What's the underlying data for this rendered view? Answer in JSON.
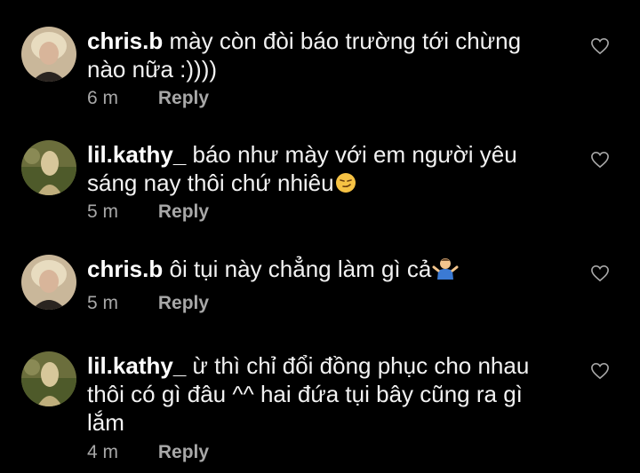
{
  "comments": [
    {
      "username": "chris.b",
      "text": "mày còn đòi báo trường tới chừng nào nữa :))))",
      "emoji": "",
      "time": "6 m",
      "reply": "Reply",
      "avatar": "avatar-chris",
      "like_icon": "heart-outline-icon"
    },
    {
      "username": "lil.kathy_",
      "text": "báo như mày với em người yêu sáng nay thôi chứ nhiêu",
      "emoji": "smirking-face-emoji",
      "time": "5 m",
      "reply": "Reply",
      "avatar": "avatar-kathy",
      "like_icon": "heart-outline-icon"
    },
    {
      "username": "chris.b",
      "text": "ôi tụi này chẳng làm gì cả",
      "emoji": "person-shrugging-emoji",
      "time": "5 m",
      "reply": "Reply",
      "avatar": "avatar-chris",
      "like_icon": "heart-outline-icon"
    },
    {
      "username": "lil.kathy_",
      "text": "ừ thì chỉ đổi đồng phục cho nhau thôi có gì đâu ^^ hai đứa tụi bây cũng ra gì lắm",
      "emoji": "",
      "time": "4 m",
      "reply": "Reply",
      "avatar": "avatar-kathy",
      "like_icon": "heart-outline-icon"
    }
  ],
  "colors": {
    "background": "#000000",
    "text": "#ffffff",
    "meta": "#a8a8a8"
  }
}
